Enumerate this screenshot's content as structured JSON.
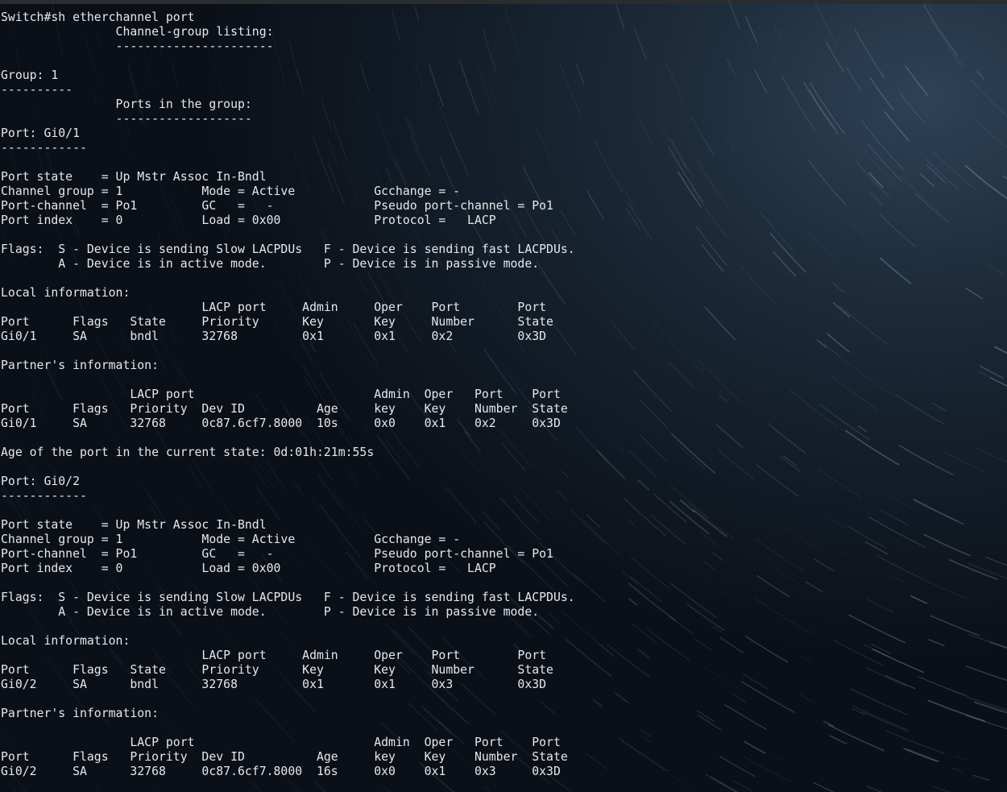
{
  "terminal": {
    "lines": [
      "Switch#sh etherchannel port",
      "                Channel-group listing:",
      "                ----------------------",
      "",
      "Group: 1",
      "----------",
      "                Ports in the group:",
      "                -------------------",
      "Port: Gi0/1",
      "------------",
      "",
      "Port state    = Up Mstr Assoc In-Bndl",
      "Channel group = 1           Mode = Active           Gcchange = -",
      "Port-channel  = Po1         GC   =   -              Pseudo port-channel = Po1",
      "Port index    = 0           Load = 0x00             Protocol =   LACP",
      "",
      "Flags:  S - Device is sending Slow LACPDUs   F - Device is sending fast LACPDUs.",
      "        A - Device is in active mode.        P - Device is in passive mode.",
      "",
      "Local information:",
      "                            LACP port     Admin     Oper    Port        Port",
      "Port      Flags   State     Priority      Key       Key     Number      State",
      "Gi0/1     SA      bndl      32768         0x1       0x1     0x2         0x3D",
      "",
      "Partner's information:",
      "",
      "                  LACP port                         Admin  Oper   Port    Port",
      "Port      Flags   Priority  Dev ID          Age     key    Key    Number  State",
      "Gi0/1     SA      32768     0c87.6cf7.8000  10s     0x0    0x1    0x2     0x3D",
      "",
      "Age of the port in the current state: 0d:01h:21m:55s",
      "",
      "Port: Gi0/2",
      "------------",
      "",
      "Port state    = Up Mstr Assoc In-Bndl",
      "Channel group = 1           Mode = Active           Gcchange = -",
      "Port-channel  = Po1         GC   =   -              Pseudo port-channel = Po1",
      "Port index    = 0           Load = 0x00             Protocol =   LACP",
      "",
      "Flags:  S - Device is sending Slow LACPDUs   F - Device is sending fast LACPDUs.",
      "        A - Device is in active mode.        P - Device is in passive mode.",
      "",
      "Local information:",
      "                            LACP port     Admin     Oper    Port        Port",
      "Port      Flags   State     Priority      Key       Key     Number      State",
      "Gi0/2     SA      bndl      32768         0x1       0x1     0x3         0x3D",
      "",
      "Partner's information:",
      "",
      "                  LACP port                         Admin  Oper   Port    Port",
      "Port      Flags   Priority  Dev ID          Age     key    Key    Number  State",
      "Gi0/2     SA      32768     0c87.6cf7.8000  16s     0x0    0x1    0x3     0x3D"
    ]
  },
  "colors": {
    "text": "#e6e8ea",
    "background": "#121b26",
    "trail": "#9fb4cc"
  }
}
